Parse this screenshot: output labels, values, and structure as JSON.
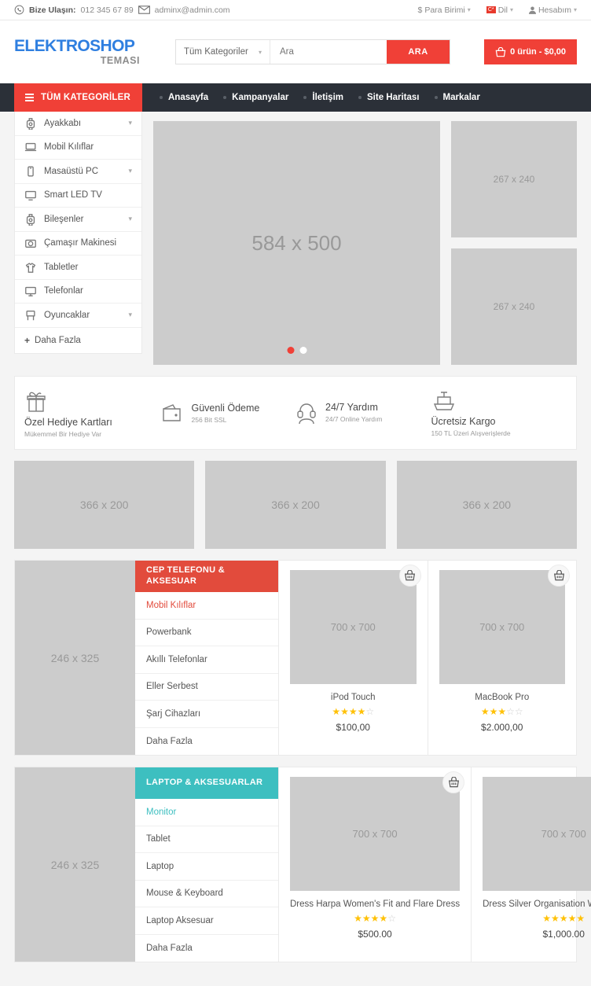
{
  "topbar": {
    "contact_label": "Bize Ulaşın:",
    "phone": "012 345 67 89",
    "email": "adminx@admin.com",
    "currency": "Para Birimi",
    "language": "Dil",
    "account": "Hesabım"
  },
  "header": {
    "logo_main": "ELEKTROSHOP",
    "logo_sub": "TEMASI",
    "category_select": "Tüm Kategoriler",
    "search_placeholder": "Ara",
    "search_button": "ARA",
    "cart_text": "0 ürün - $0,00"
  },
  "nav": {
    "all_categories": "TÜM KATEGORİLER",
    "links": [
      {
        "label": "Anasayfa"
      },
      {
        "label": "Kampanyalar"
      },
      {
        "label": "İletişim"
      },
      {
        "label": "Site Haritası"
      },
      {
        "label": "Markalar"
      }
    ]
  },
  "sidebar": {
    "items": [
      {
        "label": "Ayakkabı",
        "icon": "watch-icon",
        "caret": true
      },
      {
        "label": "Mobil Kılıflar",
        "icon": "laptop-icon",
        "caret": false
      },
      {
        "label": "Masaüstü PC",
        "icon": "phone-icon",
        "caret": true
      },
      {
        "label": "Smart LED TV",
        "icon": "tv-icon",
        "caret": false
      },
      {
        "label": "Bileşenler",
        "icon": "watch-icon",
        "caret": true
      },
      {
        "label": "Çamaşır Makinesi",
        "icon": "camera-icon",
        "caret": false
      },
      {
        "label": "Tabletler",
        "icon": "shirt-icon",
        "caret": false
      },
      {
        "label": "Telefonlar",
        "icon": "monitor-icon",
        "caret": false
      },
      {
        "label": "Oyuncaklar",
        "icon": "toy-icon",
        "caret": true
      }
    ],
    "more_label": "Daha Fazla"
  },
  "banners": {
    "main": "584 x 500",
    "side": [
      "267 x 240",
      "267 x 240"
    ],
    "three": [
      "366 x 200",
      "366 x 200",
      "366 x 200"
    ]
  },
  "services": [
    {
      "title": "Özel Hediye Kartları",
      "sub": "Mükemmel Bir Hediye Var",
      "icon": "gift-icon",
      "layout": "stacked"
    },
    {
      "title": "Güvenli Ödeme",
      "sub": "256 Bit SSL",
      "icon": "wallet-icon",
      "layout": "inline"
    },
    {
      "title": "24/7 Yardım",
      "sub": "24/7 Online Yardım",
      "icon": "headset-icon",
      "layout": "inline"
    },
    {
      "title": "Ücretsiz Kargo",
      "sub": "150 TL Üzeri Alışverişlerde",
      "icon": "ship-icon",
      "layout": "stacked"
    }
  ],
  "sections": [
    {
      "placeholder": "246 x 325",
      "head_title": "CEP TELEFONU & AKSESUAR",
      "head_color": "#e24b3c",
      "active_color": "#e24b3c",
      "nav_items": [
        "Mobil Kılıflar",
        "Powerbank",
        "Akıllı Telefonlar",
        "Eller Serbest",
        "Şarj Cihazları",
        "Daha Fazla"
      ],
      "products": [
        {
          "image": "700 x 700",
          "name": "iPod Touch",
          "rating": 4,
          "price": "$100,00"
        },
        {
          "image": "700 x 700",
          "name": "MacBook Pro",
          "rating": 3,
          "price": "$2.000,00"
        }
      ]
    },
    {
      "placeholder": "246 x 325",
      "head_title": "LAPTOP & AKSESUARLAR",
      "head_color": "#3dbfc0",
      "active_color": "#3dbfc0",
      "nav_items": [
        "Monitor",
        "Tablet",
        "Laptop",
        "Mouse & Keyboard",
        "Laptop Aksesuar",
        "Daha Fazla"
      ],
      "products": [
        {
          "image": "700 x 700",
          "name": "Dress Harpa Women's Fit and Flare Dress",
          "rating": 4,
          "price": "$500.00"
        },
        {
          "image": "700 x 700",
          "name": "Dress Silver Organisation Women Dress",
          "rating": 5,
          "price": "$1,000.00"
        }
      ]
    }
  ]
}
